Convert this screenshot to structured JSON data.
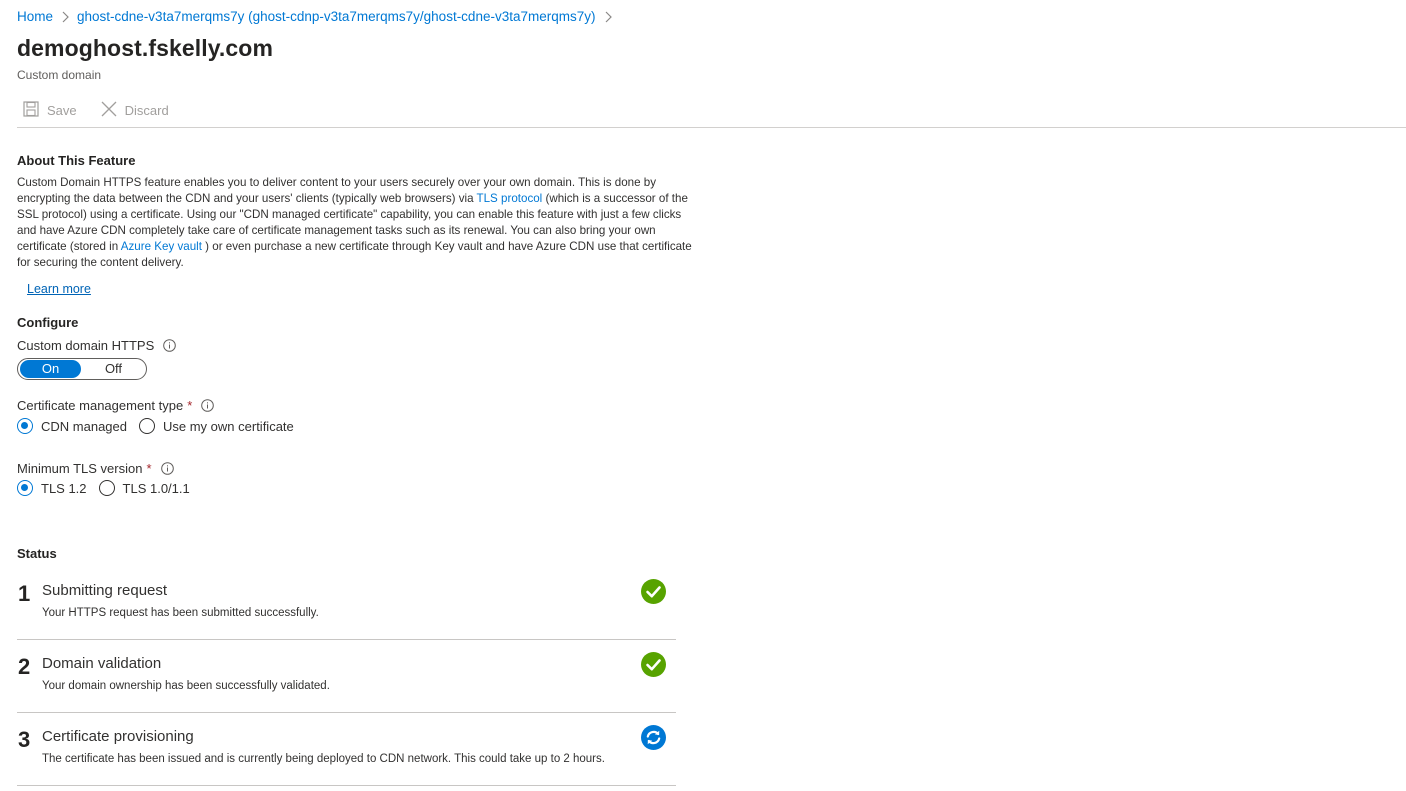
{
  "breadcrumb": {
    "items": [
      "Home",
      "ghost-cdne-v3ta7merqms7y (ghost-cdnp-v3ta7merqms7y/ghost-cdne-v3ta7merqms7y)"
    ]
  },
  "page": {
    "title": "demoghost.fskelly.com",
    "subtitle": "Custom domain"
  },
  "toolbar": {
    "save_label": "Save",
    "discard_label": "Discard"
  },
  "about": {
    "heading": "About This Feature",
    "text_part1": "Custom Domain HTTPS feature enables you to deliver content to your users securely over your own domain. This is done by encrypting the data between the CDN and your users' clients (typically web browsers) via ",
    "tls_link": "TLS protocol",
    "text_part2": " (which is a successor of the SSL protocol) using a certificate. Using our \"CDN managed certificate\" capability, you can enable this feature with just a few clicks and have Azure CDN completely take care of certificate management tasks such as its renewal. You can also bring your own certificate (stored in ",
    "keyvault_link": "Azure Key vault",
    "text_part3": " ) or even purchase a new certificate through Key vault and have Azure CDN use that certificate for securing the content delivery.",
    "learn_more": "Learn more"
  },
  "configure": {
    "heading": "Configure",
    "https_label": "Custom domain HTTPS",
    "toggle_on": "On",
    "toggle_off": "Off",
    "toggle_selected": "On",
    "cert_label": "Certificate management type",
    "cert_required": "*",
    "cert_options": [
      "CDN managed",
      "Use my own certificate"
    ],
    "cert_selected": "CDN managed",
    "tls_label": "Minimum TLS version",
    "tls_required": "*",
    "tls_options": [
      "TLS 1.2",
      "TLS 1.0/1.1"
    ],
    "tls_selected": "TLS 1.2"
  },
  "status": {
    "heading": "Status",
    "steps": [
      {
        "number": "1",
        "title": "Submitting request",
        "description": "Your HTTPS request has been submitted successfully.",
        "state": "complete",
        "icon": "success-check-icon"
      },
      {
        "number": "2",
        "title": "Domain validation",
        "description": "Your domain ownership has been successfully validated.",
        "state": "complete",
        "icon": "success-check-icon"
      },
      {
        "number": "3",
        "title": "Certificate provisioning",
        "description": "The certificate has been issued and is currently being deployed to CDN network. This could take up to 2 hours.",
        "state": "in-progress",
        "icon": "in-progress-sync-icon"
      }
    ]
  },
  "colors": {
    "accent": "#0078d4",
    "success": "#57a300",
    "in_progress": "#0078d4",
    "required": "#a4262c"
  }
}
